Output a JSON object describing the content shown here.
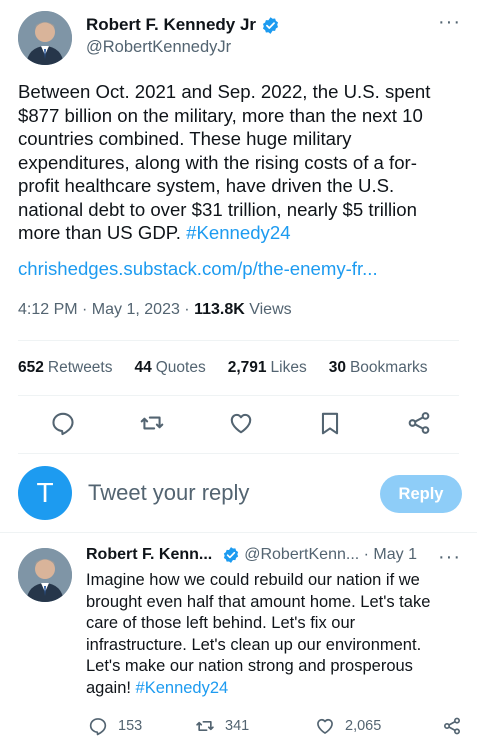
{
  "tweet": {
    "display_name": "Robert F. Kennedy Jr",
    "handle": "@RobertKennedyJr",
    "more_label": "···",
    "text": "Between Oct. 2021 and Sep. 2022, the U.S. spent $877 billion on the military, more than the next 10 countries combined. These huge military expenditures, along with the rising costs of a for-profit healthcare system, have driven the U.S. national debt to over $31 trillion, nearly $5 trillion more than US GDP. ",
    "hashtag": "#Kennedy24",
    "link": "chrishedges.substack.com/p/the-enemy-fr...",
    "time": "4:12 PM · May 1, 2023 · ",
    "views_count": "113.8K",
    "views_label": " Views"
  },
  "stats": {
    "retweets_count": "652",
    "retweets_label": "Retweets",
    "quotes_count": "44",
    "quotes_label": "Quotes",
    "likes_count": "2,791",
    "likes_label": "Likes",
    "bookmarks_count": "30",
    "bookmarks_label": "Bookmarks"
  },
  "compose": {
    "avatar_letter": "T",
    "placeholder": "Tweet your reply",
    "reply_button": "Reply"
  },
  "reply_tweet": {
    "display_name": "Robert F. Kenn...",
    "handle": "@RobertKenn... · May 1",
    "more_label": "···",
    "text": "Imagine how we could rebuild our nation if we brought even half that amount home. Let's take care of those left behind. Let's fix our infrastructure. Let's clean up our environment. Let's make our nation strong and prosperous again! ",
    "hashtag": "#Kennedy24",
    "replies": "153",
    "retweets": "341",
    "likes": "2,065"
  },
  "colors": {
    "accent": "#1d9bf0",
    "secondary_text": "#536471",
    "reply_button_disabled": "#8ecdf8"
  },
  "icons": {
    "verified": "verified-badge-icon",
    "reply": "speech-bubble-icon",
    "retweet": "retweet-arrows-icon",
    "like": "heart-icon",
    "bookmark": "bookmark-icon",
    "share": "share-icon"
  }
}
